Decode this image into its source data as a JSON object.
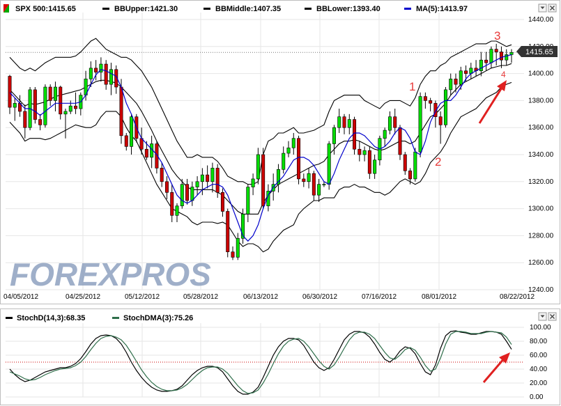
{
  "legend_main": [
    {
      "label": "SPX 500:1415.65",
      "swatch": "#00aa00",
      "swatch2": "#dd0000",
      "kind": "updown"
    },
    {
      "label": "BBUpper:1421.30",
      "swatch": "#000000",
      "kind": "line"
    },
    {
      "label": "BBMiddle:1407.35",
      "swatch": "#000000",
      "kind": "line"
    },
    {
      "label": "BBLower:1393.40",
      "swatch": "#000000",
      "kind": "line"
    },
    {
      "label": "MA(5):1413.97",
      "swatch": "#0000cc",
      "kind": "line"
    }
  ],
  "legend_stoch": [
    {
      "label": "StochD(14,3):68.35",
      "swatch": "#000000"
    },
    {
      "label": "StochDMA(3):75.26",
      "swatch": "#2e6e4a"
    }
  ],
  "last_price_label": "1415.65",
  "watermark": "FOREXPROS",
  "annotations": [
    "1",
    "2",
    "3",
    "4"
  ],
  "colors": {
    "up": "#00dd00",
    "down": "#cc0000",
    "ma": "#0000cc",
    "band": "#000000",
    "stochD": "#000000",
    "stochDMA": "#2e6e4a",
    "arrow": "#e02020",
    "ref": "#cc0000"
  },
  "chart_data": [
    {
      "type": "candlestick",
      "title": "",
      "ylim": [
        1240,
        1440
      ],
      "y_ticks": [
        "1440.00",
        "1420.00",
        "1400.00",
        "1380.00",
        "1360.00",
        "1340.00",
        "1320.00",
        "1300.00",
        "1280.00",
        "1260.00",
        "1240.00"
      ],
      "x_ticks": [
        "04/05/2012",
        "04/25/2012",
        "05/12/2012",
        "05/28/2012",
        "06/13/2012",
        "06/30/2012",
        "07/16/2012",
        "08/01/2012",
        "08/22/2012"
      ],
      "reference_line": 1415.65,
      "candles": [
        [
          1398,
          1399,
          1370,
          1375
        ],
        [
          1375,
          1382,
          1365,
          1378
        ],
        [
          1378,
          1384,
          1368,
          1372
        ],
        [
          1372,
          1377,
          1352,
          1360
        ],
        [
          1360,
          1390,
          1358,
          1388
        ],
        [
          1388,
          1390,
          1363,
          1366
        ],
        [
          1366,
          1370,
          1358,
          1362
        ],
        [
          1362,
          1392,
          1360,
          1390
        ],
        [
          1390,
          1392,
          1376,
          1380
        ],
        [
          1380,
          1394,
          1372,
          1390
        ],
        [
          1390,
          1391,
          1366,
          1370
        ],
        [
          1370,
          1374,
          1352,
          1372
        ],
        [
          1372,
          1380,
          1370,
          1376
        ],
        [
          1376,
          1386,
          1370,
          1374
        ],
        [
          1374,
          1386,
          1369,
          1384
        ],
        [
          1384,
          1402,
          1380,
          1396
        ],
        [
          1396,
          1409,
          1390,
          1404
        ],
        [
          1404,
          1410,
          1395,
          1401
        ],
        [
          1401,
          1412,
          1394,
          1407
        ],
        [
          1407,
          1410,
          1388,
          1392
        ],
        [
          1392,
          1408,
          1384,
          1403
        ],
        [
          1403,
          1406,
          1385,
          1390
        ],
        [
          1390,
          1396,
          1348,
          1354
        ],
        [
          1354,
          1356,
          1343,
          1346
        ],
        [
          1346,
          1370,
          1340,
          1368
        ],
        [
          1368,
          1370,
          1349,
          1352
        ],
        [
          1352,
          1360,
          1340,
          1344
        ],
        [
          1344,
          1350,
          1336,
          1338
        ],
        [
          1338,
          1354,
          1330,
          1348
        ],
        [
          1348,
          1350,
          1326,
          1330
        ],
        [
          1330,
          1334,
          1316,
          1320
        ],
        [
          1320,
          1324,
          1307,
          1312
        ],
        [
          1312,
          1318,
          1290,
          1295
        ],
        [
          1295,
          1304,
          1290,
          1302
        ],
        [
          1302,
          1322,
          1300,
          1318
        ],
        [
          1318,
          1322,
          1303,
          1306
        ],
        [
          1306,
          1320,
          1302,
          1316
        ],
        [
          1316,
          1324,
          1310,
          1320
        ],
        [
          1320,
          1330,
          1310,
          1325
        ],
        [
          1325,
          1332,
          1315,
          1320
        ],
        [
          1320,
          1334,
          1312,
          1330
        ],
        [
          1330,
          1333,
          1308,
          1312
        ],
        [
          1312,
          1315,
          1294,
          1298
        ],
        [
          1298,
          1300,
          1264,
          1268
        ],
        [
          1268,
          1272,
          1262,
          1264
        ],
        [
          1264,
          1282,
          1262,
          1278
        ],
        [
          1278,
          1300,
          1274,
          1296
        ],
        [
          1296,
          1318,
          1290,
          1316
        ],
        [
          1316,
          1326,
          1310,
          1322
        ],
        [
          1322,
          1345,
          1318,
          1340
        ],
        [
          1340,
          1345,
          1300,
          1302
        ],
        [
          1302,
          1318,
          1298,
          1313
        ],
        [
          1313,
          1326,
          1306,
          1318
        ],
        [
          1318,
          1333,
          1312,
          1329
        ],
        [
          1329,
          1346,
          1326,
          1341
        ],
        [
          1341,
          1350,
          1338,
          1345
        ],
        [
          1345,
          1356,
          1340,
          1352
        ],
        [
          1352,
          1354,
          1318,
          1322
        ],
        [
          1322,
          1326,
          1316,
          1320
        ],
        [
          1320,
          1330,
          1315,
          1326
        ],
        [
          1326,
          1328,
          1306,
          1310
        ],
        [
          1310,
          1322,
          1305,
          1318
        ],
        [
          1318,
          1320,
          1316,
          1318
        ],
        [
          1318,
          1350,
          1314,
          1348
        ],
        [
          1348,
          1362,
          1340,
          1360
        ],
        [
          1360,
          1374,
          1356,
          1368
        ],
        [
          1368,
          1370,
          1355,
          1360
        ],
        [
          1360,
          1370,
          1355,
          1366
        ],
        [
          1366,
          1368,
          1340,
          1344
        ],
        [
          1344,
          1350,
          1335,
          1340
        ],
        [
          1340,
          1346,
          1335,
          1343
        ],
        [
          1343,
          1346,
          1322,
          1326
        ],
        [
          1326,
          1340,
          1322,
          1336
        ],
        [
          1336,
          1354,
          1332,
          1352
        ],
        [
          1352,
          1360,
          1346,
          1358
        ],
        [
          1358,
          1372,
          1355,
          1368
        ],
        [
          1368,
          1374,
          1355,
          1360
        ],
        [
          1360,
          1362,
          1336,
          1340
        ],
        [
          1340,
          1342,
          1325,
          1328
        ],
        [
          1328,
          1330,
          1318,
          1322
        ],
        [
          1322,
          1345,
          1320,
          1342
        ],
        [
          1342,
          1386,
          1338,
          1383
        ],
        [
          1383,
          1386,
          1374,
          1380
        ],
        [
          1380,
          1382,
          1372,
          1378
        ],
        [
          1378,
          1380,
          1360,
          1368
        ],
        [
          1368,
          1372,
          1348,
          1362
        ],
        [
          1362,
          1390,
          1360,
          1388
        ],
        [
          1388,
          1400,
          1384,
          1396
        ],
        [
          1396,
          1400,
          1386,
          1392
        ],
        [
          1392,
          1405,
          1388,
          1402
        ],
        [
          1402,
          1406,
          1394,
          1400
        ],
        [
          1400,
          1408,
          1396,
          1404
        ],
        [
          1404,
          1410,
          1398,
          1402
        ],
        [
          1402,
          1416,
          1398,
          1410
        ],
        [
          1410,
          1416,
          1402,
          1408
        ],
        [
          1408,
          1420,
          1404,
          1418
        ],
        [
          1418,
          1422,
          1406,
          1416
        ],
        [
          1416,
          1420,
          1404,
          1410
        ],
        [
          1410,
          1418,
          1406,
          1414
        ],
        [
          1414,
          1418,
          1408,
          1415.65
        ]
      ],
      "bb_upper": [
        1412,
        1408,
        1404,
        1402,
        1404,
        1402,
        1405,
        1408,
        1410,
        1412,
        1412,
        1412,
        1412,
        1413,
        1416,
        1420,
        1424,
        1426,
        1422,
        1418,
        1416,
        1414,
        1412,
        1412,
        1410,
        1406,
        1402,
        1396,
        1390,
        1382,
        1374,
        1366,
        1358,
        1350,
        1344,
        1338,
        1338,
        1340,
        1338,
        1338,
        1338,
        1335,
        1330,
        1324,
        1322,
        1320,
        1320,
        1318,
        1318,
        1320,
        1340,
        1350,
        1352,
        1356,
        1356,
        1358,
        1360,
        1356,
        1356,
        1357,
        1358,
        1360,
        1362,
        1372,
        1380,
        1382,
        1384,
        1384,
        1384,
        1384,
        1380,
        1378,
        1376,
        1374,
        1378,
        1380,
        1380,
        1380,
        1378,
        1376,
        1382,
        1392,
        1398,
        1402,
        1402,
        1406,
        1408,
        1412,
        1414,
        1416,
        1418,
        1420,
        1422,
        1422,
        1422,
        1424,
        1424,
        1422,
        1420,
        1421.3
      ],
      "bb_middle": [
        1388,
        1384,
        1380,
        1376,
        1378,
        1377,
        1378,
        1379,
        1381,
        1383,
        1384,
        1385,
        1386,
        1387,
        1388,
        1390,
        1392,
        1394,
        1395,
        1395,
        1394,
        1393,
        1390,
        1386,
        1382,
        1378,
        1372,
        1365,
        1358,
        1350,
        1343,
        1336,
        1329,
        1324,
        1320,
        1316,
        1314,
        1314,
        1314,
        1314,
        1314,
        1312,
        1310,
        1306,
        1302,
        1298,
        1296,
        1296,
        1296,
        1296,
        1304,
        1310,
        1314,
        1318,
        1320,
        1322,
        1324,
        1326,
        1328,
        1330,
        1332,
        1333,
        1335,
        1340,
        1344,
        1348,
        1350,
        1350,
        1351,
        1350,
        1348,
        1346,
        1344,
        1343,
        1344,
        1346,
        1348,
        1350,
        1350,
        1348,
        1350,
        1356,
        1362,
        1368,
        1370,
        1374,
        1378,
        1384,
        1388,
        1392,
        1394,
        1396,
        1398,
        1400,
        1402,
        1404,
        1405,
        1406,
        1406,
        1407.35
      ],
      "bb_lower": [
        1364,
        1360,
        1356,
        1350,
        1352,
        1352,
        1352,
        1351,
        1352,
        1354,
        1356,
        1358,
        1360,
        1362,
        1361,
        1360,
        1360,
        1362,
        1368,
        1372,
        1372,
        1372,
        1368,
        1360,
        1354,
        1350,
        1342,
        1334,
        1326,
        1318,
        1312,
        1306,
        1300,
        1298,
        1296,
        1294,
        1290,
        1288,
        1290,
        1290,
        1290,
        1289,
        1290,
        1288,
        1282,
        1276,
        1272,
        1274,
        1274,
        1272,
        1268,
        1270,
        1276,
        1280,
        1284,
        1286,
        1288,
        1296,
        1300,
        1303,
        1306,
        1306,
        1308,
        1308,
        1308,
        1314,
        1316,
        1316,
        1318,
        1316,
        1316,
        1314,
        1312,
        1312,
        1310,
        1312,
        1316,
        1320,
        1322,
        1320,
        1318,
        1320,
        1326,
        1334,
        1338,
        1342,
        1348,
        1356,
        1362,
        1368,
        1370,
        1372,
        1374,
        1378,
        1382,
        1384,
        1386,
        1390,
        1392,
        1393.4
      ],
      "ma5": [
        1386,
        1382,
        1378,
        1374,
        1374,
        1372,
        1369,
        1372,
        1375,
        1378,
        1378,
        1378,
        1378,
        1378,
        1379,
        1384,
        1392,
        1399,
        1403,
        1402,
        1400,
        1398,
        1390,
        1378,
        1370,
        1360,
        1352,
        1348,
        1344,
        1340,
        1334,
        1326,
        1318,
        1310,
        1306,
        1304,
        1306,
        1310,
        1314,
        1316,
        1318,
        1318,
        1316,
        1310,
        1300,
        1290,
        1280,
        1276,
        1280,
        1288,
        1300,
        1310,
        1316,
        1320,
        1324,
        1330,
        1336,
        1338,
        1338,
        1336,
        1332,
        1326,
        1320,
        1318,
        1326,
        1336,
        1344,
        1352,
        1356,
        1356,
        1354,
        1350,
        1346,
        1344,
        1346,
        1350,
        1356,
        1360,
        1358,
        1352,
        1342,
        1340,
        1350,
        1364,
        1372,
        1378,
        1380,
        1380,
        1384,
        1390,
        1396,
        1400,
        1402,
        1404,
        1406,
        1408,
        1410,
        1412,
        1413,
        1413.97
      ]
    },
    {
      "type": "line",
      "title": "",
      "ylim": [
        0,
        100
      ],
      "y_ticks": [
        "100.00",
        "80.00",
        "60.00",
        "40.00",
        "20.00",
        "0.00"
      ],
      "reference_line": 50,
      "series": [
        {
          "name": "StochD(14,3):68.35",
          "values": [
            40,
            32,
            26,
            22,
            24,
            28,
            32,
            36,
            38,
            40,
            42,
            42,
            44,
            48,
            55,
            65,
            76,
            84,
            88,
            89,
            88,
            84,
            76,
            64,
            50,
            38,
            28,
            20,
            14,
            10,
            8,
            8,
            9,
            11,
            16,
            24,
            32,
            38,
            42,
            44,
            44,
            42,
            36,
            26,
            16,
            8,
            4,
            4,
            7,
            14,
            28,
            44,
            60,
            72,
            80,
            84,
            84,
            82,
            74,
            62,
            50,
            42,
            38,
            42,
            54,
            68,
            82,
            90,
            94,
            94,
            92,
            86,
            76,
            64,
            54,
            50,
            56,
            66,
            72,
            70,
            62,
            48,
            36,
            32,
            46,
            70,
            88,
            94,
            95,
            93,
            92,
            90,
            90,
            92,
            94,
            94,
            93,
            90,
            80,
            68.35
          ]
        },
        {
          "name": "StochDMA(3):75.26",
          "values": [
            36,
            33,
            30,
            26,
            24,
            25,
            28,
            32,
            35,
            38,
            40,
            41,
            42,
            45,
            50,
            58,
            68,
            77,
            84,
            87,
            88,
            86,
            82,
            74,
            63,
            51,
            39,
            29,
            21,
            15,
            11,
            9,
            9,
            10,
            13,
            18,
            25,
            32,
            38,
            42,
            43,
            43,
            40,
            34,
            25,
            16,
            9,
            5,
            6,
            10,
            20,
            33,
            48,
            62,
            73,
            80,
            83,
            84,
            80,
            72,
            62,
            52,
            44,
            40,
            46,
            57,
            70,
            82,
            90,
            93,
            93,
            90,
            84,
            74,
            64,
            56,
            54,
            60,
            68,
            71,
            67,
            57,
            45,
            37,
            40,
            56,
            76,
            90,
            94,
            94,
            93,
            91,
            91,
            91,
            93,
            94,
            93,
            92,
            86,
            75.26
          ]
        }
      ]
    }
  ]
}
